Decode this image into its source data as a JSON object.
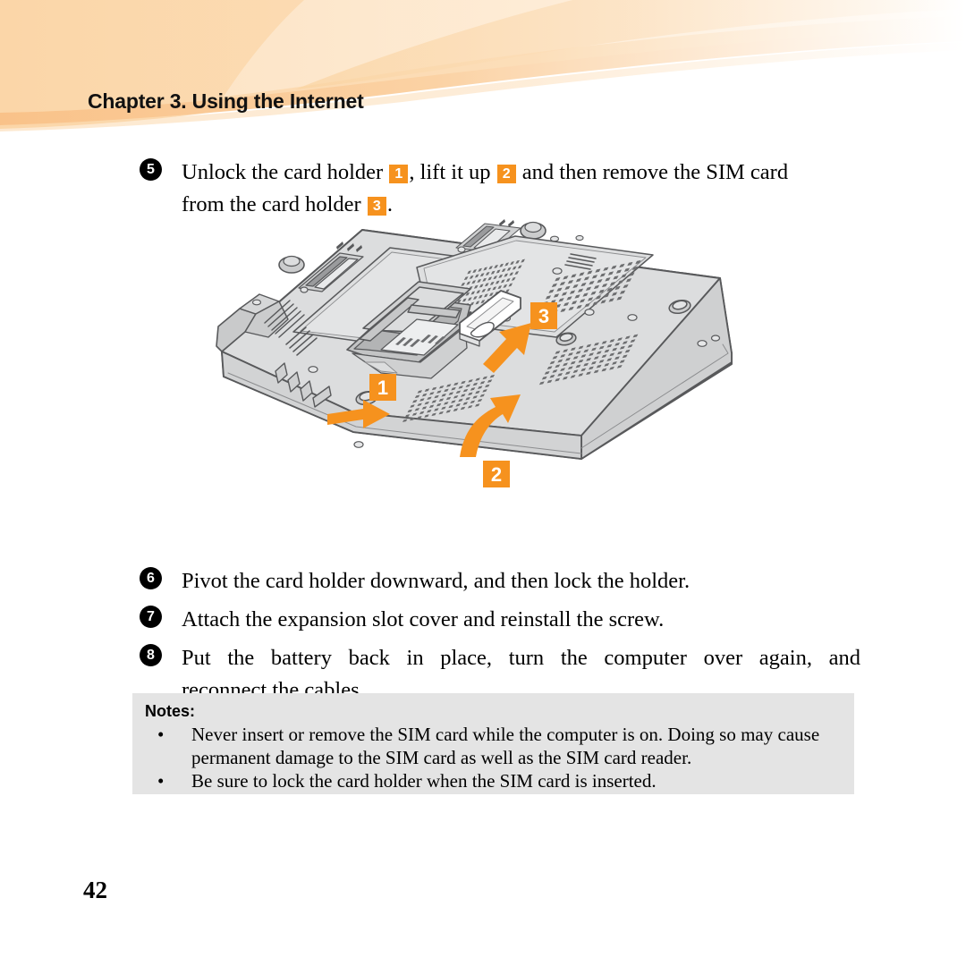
{
  "header": {
    "chapter_title": "Chapter 3. Using the Internet",
    "band_color_primary": "#FBD6A8",
    "band_color_secondary": "#FDE6CB",
    "band_color_accent": "#F9C98E"
  },
  "steps": [
    {
      "number": "5",
      "line1_a": "Unlock the card holder ",
      "badge1": "1",
      "line1_b": ", lift it up ",
      "badge2": "2",
      "line1_c": " and then remove the SIM card",
      "line2_a": "from the card holder ",
      "badge3": "3",
      "line2_b": "."
    },
    {
      "number": "6",
      "text": "Pivot the card holder downward, and then lock the holder."
    },
    {
      "number": "7",
      "text": "Attach the expansion slot cover and reinstall the screw."
    },
    {
      "number": "8",
      "text": "Put the battery back in place, turn the computer over again, and",
      "text_last": "reconnect the cables."
    }
  ],
  "figure": {
    "caption": "bottom view of laptop with SIM card holder open",
    "callouts": [
      {
        "label": "1",
        "meaning": "unlock the card holder"
      },
      {
        "label": "2",
        "meaning": "lift it up"
      },
      {
        "label": "3",
        "meaning": "remove the SIM card"
      }
    ],
    "accent_color": "#F6921E",
    "body_color": "#D8D9DA",
    "outline_color": "#58595B"
  },
  "notes": {
    "title": "Notes:",
    "bullet_glyph": "•",
    "items": [
      "Never insert or remove the SIM card while the computer is on. Doing so may cause permanent damage to the SIM card as well as the SIM card reader.",
      "Be sure to lock the card holder when the SIM card is inserted."
    ],
    "background": "#E4E4E4"
  },
  "footer": {
    "page_number": "42"
  }
}
